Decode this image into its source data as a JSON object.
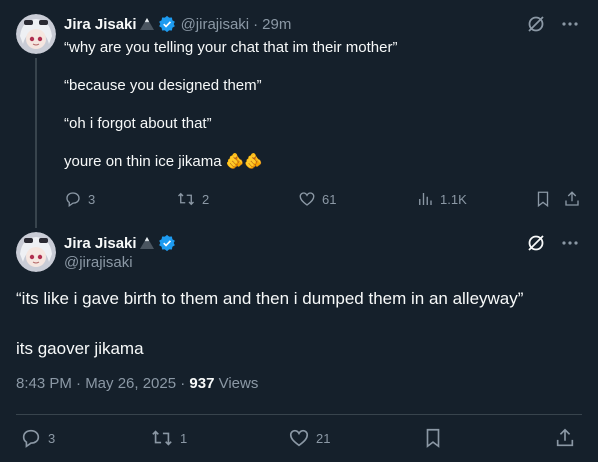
{
  "reply_tweet": {
    "author_name": "Jira Jisaki",
    "handle": "@jirajisaki",
    "separator": "·",
    "time": "29m",
    "lines": [
      "“why are you telling your chat that im their mother”",
      "“because you designed them”",
      "“oh i forgot about that”",
      "youre on thin ice jikama 🫵🫵"
    ],
    "stats": {
      "replies": "3",
      "reposts": "2",
      "likes": "61",
      "views": "1.1K"
    }
  },
  "main_tweet": {
    "author_name": "Jira Jisaki",
    "handle": "@jirajisaki",
    "lines": [
      "“its like i gave birth to them and then i dumped them in an alleyway”",
      "its gaover jikama"
    ],
    "timestamp": "8:43 PM · May 26, 2025 · ",
    "views_count": "937",
    "views_label": " Views",
    "stats": {
      "replies": "3",
      "reposts": "1",
      "likes": "21"
    }
  },
  "colors": {
    "background": "#15202b",
    "text": "#f7f9f9",
    "muted": "#8b98a5",
    "verified": "#1d9bf0",
    "divider": "#38444d"
  },
  "icons": [
    "verified-badge-icon",
    "mountain-emoji-icon",
    "grok-icon",
    "more-icon",
    "reply-icon",
    "repost-icon",
    "like-icon",
    "views-icon",
    "bookmark-icon",
    "share-icon"
  ]
}
